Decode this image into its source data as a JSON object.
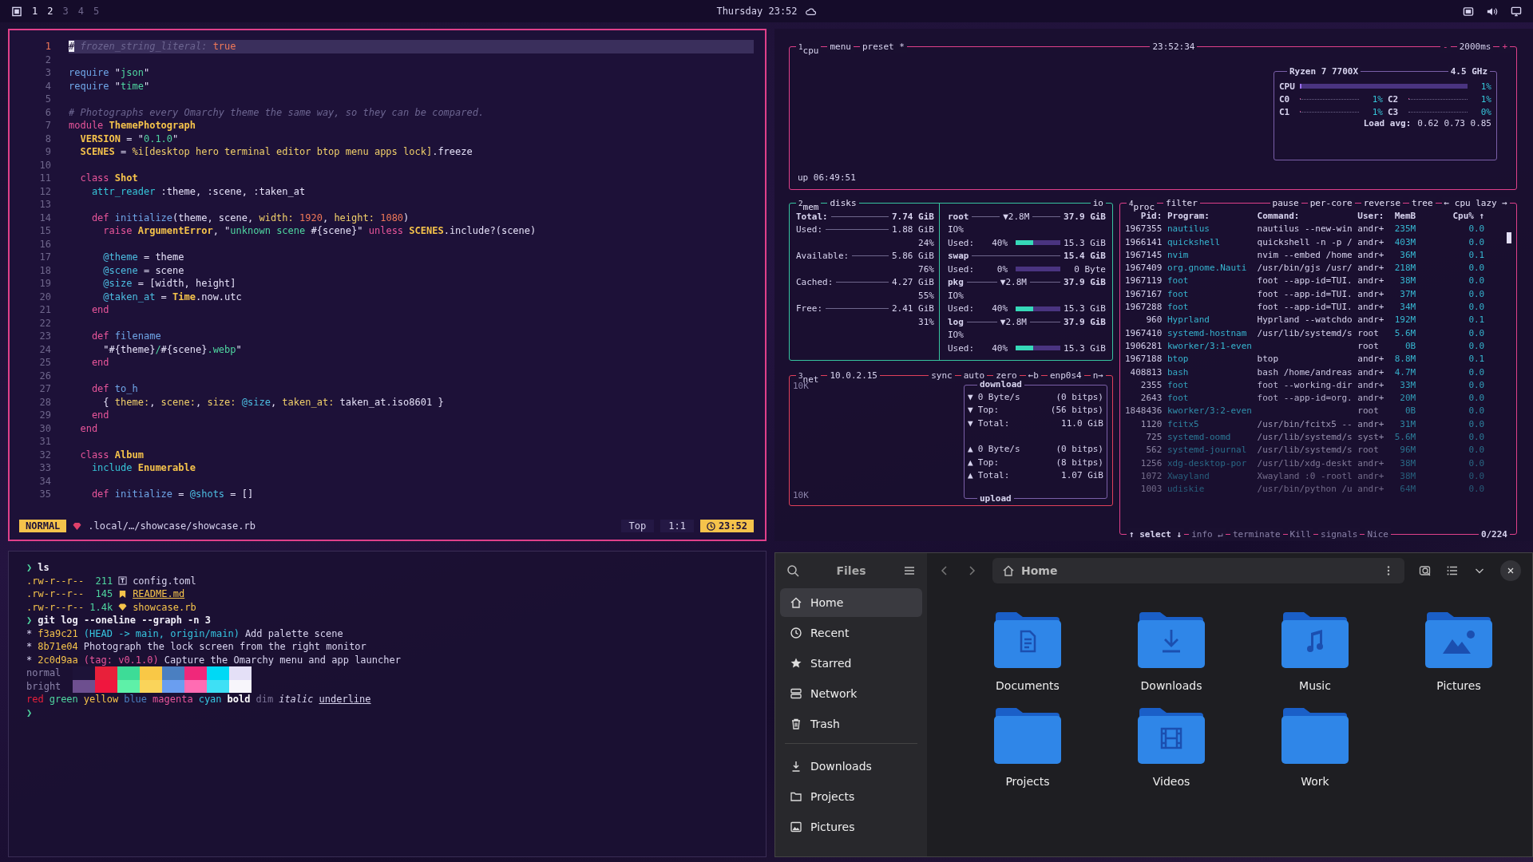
{
  "topbar": {
    "workspaces": [
      {
        "label": "1",
        "occupied": true
      },
      {
        "label": "2",
        "occupied": true
      },
      {
        "label": "3",
        "occupied": false
      },
      {
        "label": "4",
        "occupied": false
      },
      {
        "label": "5",
        "occupied": false
      }
    ],
    "clock": "Thursday 23:52"
  },
  "editor": {
    "lines": [
      {
        "n": "1",
        "current": true,
        "tokens": [
          {
            "t": "#",
            "kind": "cursor"
          },
          {
            "t": " frozen_string_literal:",
            "kind": "cm"
          },
          {
            "t": " true",
            "kind": "num"
          }
        ]
      },
      {
        "n": "2",
        "current": false
      },
      {
        "n": "3",
        "current": false,
        "tokens": [
          {
            "t": "require",
            "kind": "fn"
          },
          {
            "t": " \"",
            "kind": "plain"
          },
          {
            "t": "json",
            "kind": "str"
          },
          {
            "t": "\"",
            "kind": "plain"
          }
        ]
      },
      {
        "n": "4",
        "current": false,
        "tokens": [
          {
            "t": "require",
            "kind": "fn"
          },
          {
            "t": " \"",
            "kind": "plain"
          },
          {
            "t": "time",
            "kind": "str"
          },
          {
            "t": "\"",
            "kind": "plain"
          }
        ]
      },
      {
        "n": "5",
        "current": false
      },
      {
        "n": "6",
        "current": false,
        "tokens": [
          {
            "t": "# Photographs every Omarchy theme the same way, so they can be compared.",
            "kind": "cm"
          }
        ]
      },
      {
        "n": "7",
        "current": false,
        "tokens": [
          {
            "t": "module",
            "kind": "kw"
          },
          {
            "t": " ThemePhotograph",
            "kind": "const"
          }
        ]
      },
      {
        "n": "8",
        "current": false,
        "tokens": [
          {
            "t": "  VERSION",
            "kind": "const"
          },
          {
            "t": " = \"",
            "kind": "plain"
          },
          {
            "t": "0.1.0",
            "kind": "str"
          },
          {
            "t": "\"",
            "kind": "plain"
          }
        ]
      },
      {
        "n": "9",
        "current": false,
        "tokens": [
          {
            "t": "  SCENES",
            "kind": "const"
          },
          {
            "t": " = ",
            "kind": "plain"
          },
          {
            "t": "%i[desktop hero terminal editor btop menu apps lock]",
            "kind": "sym"
          },
          {
            "t": ".freeze",
            "kind": "plain"
          }
        ]
      },
      {
        "n": "10",
        "current": false
      },
      {
        "n": "11",
        "current": false,
        "tokens": [
          {
            "t": "  class",
            "kind": "kw"
          },
          {
            "t": " Shot",
            "kind": "const"
          }
        ]
      },
      {
        "n": "12",
        "current": false,
        "tokens": [
          {
            "t": "    attr_reader",
            "kind": "builtin"
          },
          {
            "t": " :theme, :scene, :taken_at",
            "kind": "plain"
          }
        ]
      },
      {
        "n": "13",
        "current": false
      },
      {
        "n": "14",
        "current": false,
        "tokens": [
          {
            "t": "    def",
            "kind": "kw"
          },
          {
            "t": " initialize",
            "kind": "fn"
          },
          {
            "t": "(theme, scene, ",
            "kind": "plain"
          },
          {
            "t": "width:",
            "kind": "sym"
          },
          {
            "t": " 1920",
            "kind": "num"
          },
          {
            "t": ", ",
            "kind": "plain"
          },
          {
            "t": "height:",
            "kind": "sym"
          },
          {
            "t": " 1080",
            "kind": "num"
          },
          {
            "t": ")",
            "kind": "plain"
          }
        ]
      },
      {
        "n": "15",
        "current": false,
        "tokens": [
          {
            "t": "      raise",
            "kind": "kw"
          },
          {
            "t": " ArgumentError",
            "kind": "const"
          },
          {
            "t": ", \"",
            "kind": "plain"
          },
          {
            "t": "unknown scene ",
            "kind": "str"
          },
          {
            "t": "#{scene}\"",
            "kind": "plain"
          },
          {
            "t": " unless",
            "kind": "kw"
          },
          {
            "t": " SCENES",
            "kind": "const"
          },
          {
            "t": ".include?(scene)",
            "kind": "plain"
          }
        ]
      },
      {
        "n": "16",
        "current": false
      },
      {
        "n": "17",
        "current": false,
        "tokens": [
          {
            "t": "      @theme",
            "kind": "ivar"
          },
          {
            "t": " = theme",
            "kind": "plain"
          }
        ]
      },
      {
        "n": "18",
        "current": false,
        "tokens": [
          {
            "t": "      @scene",
            "kind": "ivar"
          },
          {
            "t": " = scene",
            "kind": "plain"
          }
        ]
      },
      {
        "n": "19",
        "current": false,
        "tokens": [
          {
            "t": "      @size",
            "kind": "ivar"
          },
          {
            "t": " = [width, height]",
            "kind": "plain"
          }
        ]
      },
      {
        "n": "20",
        "current": false,
        "tokens": [
          {
            "t": "      @taken_at",
            "kind": "ivar"
          },
          {
            "t": " = ",
            "kind": "plain"
          },
          {
            "t": "Time",
            "kind": "const"
          },
          {
            "t": ".now.utc",
            "kind": "plain"
          }
        ]
      },
      {
        "n": "21",
        "current": false,
        "tokens": [
          {
            "t": "    end",
            "kind": "kw"
          }
        ]
      },
      {
        "n": "22",
        "current": false
      },
      {
        "n": "23",
        "current": false,
        "tokens": [
          {
            "t": "    def",
            "kind": "kw"
          },
          {
            "t": " filename",
            "kind": "fn"
          }
        ]
      },
      {
        "n": "24",
        "current": false,
        "tokens": [
          {
            "t": "      \"#{theme}",
            "kind": "plain"
          },
          {
            "t": "/",
            "kind": "str"
          },
          {
            "t": "#{scene}",
            "kind": "plain"
          },
          {
            "t": ".webp",
            "kind": "str"
          },
          {
            "t": "\"",
            "kind": "plain"
          }
        ]
      },
      {
        "n": "25",
        "current": false,
        "tokens": [
          {
            "t": "    end",
            "kind": "kw"
          }
        ]
      },
      {
        "n": "26",
        "current": false
      },
      {
        "n": "27",
        "current": false,
        "tokens": [
          {
            "t": "    def",
            "kind": "kw"
          },
          {
            "t": " to_h",
            "kind": "fn"
          }
        ]
      },
      {
        "n": "28",
        "current": false,
        "tokens": [
          {
            "t": "      { ",
            "kind": "plain"
          },
          {
            "t": "theme:",
            "kind": "sym"
          },
          {
            "t": ", ",
            "kind": "plain"
          },
          {
            "t": "scene:",
            "kind": "sym"
          },
          {
            "t": ", ",
            "kind": "plain"
          },
          {
            "t": "size:",
            "kind": "sym"
          },
          {
            "t": " @size",
            "kind": "ivar"
          },
          {
            "t": ", ",
            "kind": "plain"
          },
          {
            "t": "taken_at:",
            "kind": "sym"
          },
          {
            "t": " taken_at.iso8601 }",
            "kind": "plain"
          }
        ]
      },
      {
        "n": "29",
        "current": false,
        "tokens": [
          {
            "t": "    end",
            "kind": "kw"
          }
        ]
      },
      {
        "n": "30",
        "current": false,
        "tokens": [
          {
            "t": "  end",
            "kind": "kw"
          }
        ]
      },
      {
        "n": "31",
        "current": false
      },
      {
        "n": "32",
        "current": false,
        "tokens": [
          {
            "t": "  class",
            "kind": "kw"
          },
          {
            "t": " Album",
            "kind": "const"
          }
        ]
      },
      {
        "n": "33",
        "current": false,
        "tokens": [
          {
            "t": "    include",
            "kind": "builtin"
          },
          {
            "t": " Enumerable",
            "kind": "const"
          }
        ]
      },
      {
        "n": "34",
        "current": false
      },
      {
        "n": "35",
        "current": false,
        "tokens": [
          {
            "t": "    def",
            "kind": "kw"
          },
          {
            "t": " initialize",
            "kind": "fn"
          },
          {
            "t": " = ",
            "kind": "plain"
          },
          {
            "t": "@shots",
            "kind": "ivar"
          },
          {
            "t": " = []",
            "kind": "plain"
          }
        ]
      }
    ],
    "status": {
      "mode": "NORMAL",
      "path": ".local/…/showcase/showcase.rb",
      "scroll": "Top",
      "position": "1:1",
      "time": "23:52"
    }
  },
  "btop": {
    "cpu": {
      "tabs": [
        "$^{1}$cpu",
        "menu",
        "preset *"
      ],
      "clock": "23:52:34",
      "interval_dec": "-",
      "interval": "2000ms",
      "interval_inc": "+",
      "uptime": "up 06:49:51",
      "model": "Ryzen 7 7700X",
      "freq": "4.5 GHz",
      "total": {
        "label": "CPU",
        "level": 0.01,
        "reading": "1%"
      },
      "cores": [
        {
          "label": "C0",
          "level": 0.01,
          "reading": "1%"
        },
        {
          "label": "C2",
          "level": 0.01,
          "reading": "1%"
        },
        {
          "label": "C1",
          "level": 0.01,
          "reading": "1%"
        },
        {
          "label": "C3",
          "level": 0,
          "reading": "0%"
        }
      ],
      "load_label": "Load avg:",
      "load": "0.62 0.73 0.85"
    },
    "mem": {
      "title": "$^{2}$mem",
      "rows": [
        {
          "label": "Total:",
          "value": "7.74 GiB"
        },
        {
          "label": "Used:",
          "value": "1.88 GiB",
          "percent": "24%"
        },
        {
          "label": "Available:",
          "value": "5.86 GiB",
          "percent": "76%"
        },
        {
          "label": "Cached:",
          "value": "4.27 GiB",
          "percent": "55%"
        },
        {
          "label": "Free:",
          "value": "2.41 GiB",
          "percent": "31%"
        }
      ]
    },
    "disks": {
      "title": "disks",
      "io_title": "io",
      "items": [
        {
          "name": "root",
          "io_rate": "▼2.8M",
          "size": "37.9 GiB",
          "io_label": "IO%",
          "used_label": "Used:",
          "used_pct": "40%",
          "level": 0.4,
          "used": "15.3 GiB"
        },
        {
          "name": "swap",
          "size": "15.4 GiB",
          "used_label": "Used:",
          "used_pct": "0%",
          "level": 0,
          "used": "0 Byte"
        },
        {
          "name": "pkg",
          "io_rate": "▼2.8M",
          "size": "37.9 GiB",
          "io_label": "IO%",
          "used_label": "Used:",
          "used_pct": "40%",
          "level": 0.4,
          "used": "15.3 GiB"
        },
        {
          "name": "log",
          "io_rate": "▼2.8M",
          "size": "37.9 GiB",
          "io_label": "IO%",
          "used_label": "Used:",
          "used_pct": "40%",
          "level": 0.4,
          "used": "15.3 GiB"
        }
      ]
    },
    "net": {
      "title": "$^{3}$net",
      "address": "10.0.2.15",
      "options": [
        "sync",
        "auto",
        "zero",
        "←b",
        "enp0s4",
        "n→"
      ],
      "scale_top": "10K",
      "scale_bottom": "10K",
      "download_title": "download",
      "upload_title": "upload",
      "download": [
        {
          "arrow": "▼",
          "label": "0 Byte/s",
          "value": "(0 bitps)"
        },
        {
          "arrow": "▼",
          "label": "Top:",
          "value": "(56 bitps)"
        },
        {
          "arrow": "▼",
          "label": "Total:",
          "value": "11.0 GiB"
        }
      ],
      "upload": [
        {
          "arrow": "▲",
          "label": "0 Byte/s",
          "value": "(0 bitps)"
        },
        {
          "arrow": "▲",
          "label": "Top:",
          "value": "(8 bitps)"
        },
        {
          "arrow": "▲",
          "label": "Total:",
          "value": "1.07 GiB"
        }
      ]
    },
    "proc": {
      "title": "$^{4}$proc",
      "filter": "filter",
      "options": [
        "pause",
        "per-core",
        "reverse",
        "tree",
        "← cpu lazy →"
      ],
      "columns": [
        "Pid:",
        "Program:",
        "Command:",
        "User:",
        "MemB",
        "Cpu% ↑"
      ],
      "rows": [
        {
          "pid": "1967355",
          "program": "nautilus",
          "command": "nautilus --new-win",
          "user": "andr+",
          "mem": "235M",
          "cpu": "0.0"
        },
        {
          "pid": "1966141",
          "program": "quickshell",
          "command": "quickshell -n -p /",
          "user": "andr+",
          "mem": "403M",
          "cpu": "0.0"
        },
        {
          "pid": "1967145",
          "program": "nvim",
          "command": "nvim --embed /home",
          "user": "andr+",
          "mem": "36M",
          "cpu": "0.1"
        },
        {
          "pid": "1967409",
          "program": "org.gnome.Nauti",
          "command": "/usr/bin/gjs /usr/",
          "user": "andr+",
          "mem": "218M",
          "cpu": "0.0"
        },
        {
          "pid": "1967119",
          "program": "foot",
          "command": "foot --app-id=TUI.",
          "user": "andr+",
          "mem": "38M",
          "cpu": "0.0"
        },
        {
          "pid": "1967167",
          "program": "foot",
          "command": "foot --app-id=TUI.",
          "user": "andr+",
          "mem": "37M",
          "cpu": "0.0"
        },
        {
          "pid": "1967288",
          "program": "foot",
          "command": "foot --app-id=TUI.",
          "user": "andr+",
          "mem": "34M",
          "cpu": "0.0"
        },
        {
          "pid": "960",
          "program": "Hyprland",
          "command": "Hyprland --watchdo",
          "user": "andr+",
          "mem": "192M",
          "cpu": "0.1"
        },
        {
          "pid": "1967410",
          "program": "systemd-hostnam",
          "command": "/usr/lib/systemd/s",
          "user": "root",
          "mem": "5.6M",
          "cpu": "0.0"
        },
        {
          "pid": "1906281",
          "program": "kworker/3:1-even",
          "user": "root",
          "mem": "0B",
          "cpu": "0.0"
        },
        {
          "pid": "1967188",
          "program": "btop",
          "command": "btop",
          "user": "andr+",
          "mem": "8.8M",
          "cpu": "0.1"
        },
        {
          "pid": "408813",
          "program": "bash",
          "command": "bash /home/andreas",
          "user": "andr+",
          "mem": "4.7M",
          "cpu": "0.0"
        },
        {
          "pid": "2355",
          "program": "foot",
          "command": "foot --working-dir",
          "user": "andr+",
          "mem": "33M",
          "cpu": "0.0"
        },
        {
          "pid": "2643",
          "program": "foot",
          "command": "foot --app-id=org.",
          "user": "andr+",
          "mem": "20M",
          "cpu": "0.0"
        },
        {
          "pid": "1848436",
          "program": "kworker/3:2-even",
          "user": "root",
          "mem": "0B",
          "cpu": "0.0"
        },
        {
          "pid": "1120",
          "program": "fcitx5",
          "command": "/usr/bin/fcitx5 --",
          "user": "andr+",
          "mem": "31M",
          "cpu": "0.0"
        },
        {
          "pid": "725",
          "program": "systemd-oomd",
          "command": "/usr/lib/systemd/s",
          "user": "syst+",
          "mem": "5.6M",
          "cpu": "0.0"
        },
        {
          "pid": "562",
          "program": "systemd-journal",
          "command": "/usr/lib/systemd/s",
          "user": "root",
          "mem": "96M",
          "cpu": "0.0"
        },
        {
          "pid": "1256",
          "program": "xdg-desktop-por",
          "command": "/usr/lib/xdg-deskt",
          "user": "andr+",
          "mem": "38M",
          "cpu": "0.0"
        },
        {
          "pid": "1072",
          "program": "Xwayland",
          "command": "Xwayland :0 -rootl",
          "user": "andr+",
          "mem": "38M",
          "cpu": "0.0"
        },
        {
          "pid": "1003",
          "program": "udiskie",
          "command": "/usr/bin/python /u",
          "user": "andr+",
          "mem": "64M",
          "cpu": "0.0"
        }
      ],
      "footer": [
        "↑ select ↓",
        "info ↵",
        "terminate",
        "Kill",
        "signals",
        "Nice"
      ],
      "count": "0/224"
    }
  },
  "terminal": {
    "lines": [
      {
        "kind": "prompt",
        "symbol": "❯",
        "cmd": "ls"
      },
      {
        "kind": "file",
        "perms": ".rw-r--r--",
        "size": "211",
        "icon": {
          "kind": "toml"
        },
        "name": "config.toml"
      },
      {
        "kind": "file",
        "perms": ".rw-r--r--",
        "size": "145",
        "icon": {
          "kind": "markdown"
        },
        "name": "README.md"
      },
      {
        "kind": "file",
        "perms": ".rw-r--r--",
        "size": "1.4k",
        "icon": {
          "kind": "ruby"
        },
        "name": "showcase.rb"
      },
      {
        "kind": "prompt",
        "symbol": "❯",
        "cmd": "git log --oneline --graph -n 3"
      },
      {
        "kind": "commit",
        "graph": "*",
        "hash": "f3a9c21",
        "refs": {
          "t": "(HEAD -> main, origin/main)",
          "kind": "head"
        },
        "message": "Add palette scene"
      },
      {
        "kind": "commit",
        "graph": "*",
        "hash": "8b71e04",
        "message": "Photograph the lock screen from the right monitor"
      },
      {
        "kind": "commit",
        "graph": "*",
        "hash": "2c0d9aa",
        "refs": {
          "t": "(tag: v0.1.0)",
          "kind": "tag"
        },
        "message": "Capture the Omarchy menu and app launcher"
      },
      {
        "kind": "palette",
        "label": "normal",
        "colors": [
          {
            "color": "#1d1338"
          },
          {
            "color": "#e8203a"
          },
          {
            "color": "#3ddc97"
          },
          {
            "color": "#f9c846"
          },
          {
            "color": "#4a7fc1"
          },
          {
            "color": "#f0287a"
          },
          {
            "color": "#00d9f5"
          },
          {
            "color": "#e4e0f7"
          }
        ]
      },
      {
        "kind": "palette",
        "label": "bright",
        "colors": [
          {
            "color": "#6d4f8f"
          },
          {
            "color": "#f0163e"
          },
          {
            "color": "#5ef0a8"
          },
          {
            "color": "#fad45a"
          },
          {
            "color": "#6a9ef0"
          },
          {
            "color": "#ff6cb3"
          },
          {
            "color": "#3ee0f5"
          },
          {
            "color": "#f7f6fb"
          }
        ]
      },
      {
        "kind": "styles",
        "words": [
          {
            "t": "red",
            "kind": "red"
          },
          {
            "t": "green",
            "kind": "green"
          },
          {
            "t": "yellow",
            "kind": "yellow"
          },
          {
            "t": "blue",
            "kind": "blue"
          },
          {
            "t": "magenta",
            "kind": "magenta"
          },
          {
            "t": "cyan",
            "kind": "cyan"
          },
          {
            "t": "bold",
            "kind": "bold"
          },
          {
            "t": "dim",
            "kind": "dim"
          },
          {
            "t": "italic",
            "kind": "italic"
          },
          {
            "t": "underline",
            "kind": "underline"
          }
        ]
      },
      {
        "kind": "prompt",
        "symbol": "❯"
      }
    ]
  },
  "files": {
    "title": "Files",
    "path": "Home",
    "places": [
      {
        "label": "Home",
        "kind": "home",
        "selected": true
      },
      {
        "label": "Recent",
        "kind": "clock",
        "selected": false
      },
      {
        "label": "Starred",
        "kind": "star",
        "selected": false
      },
      {
        "label": "Network",
        "kind": "network",
        "selected": false
      },
      {
        "label": "Trash",
        "kind": "trash",
        "selected": false
      }
    ],
    "bookmarks": [
      {
        "label": "Downloads",
        "kind": "download",
        "selected": false
      },
      {
        "label": "Projects",
        "kind": "folder",
        "selected": false
      },
      {
        "label": "Pictures",
        "kind": "image",
        "selected": false
      }
    ],
    "folders": [
      {
        "label": "Documents",
        "kind": "documents"
      },
      {
        "label": "Downloads",
        "kind": "downloads"
      },
      {
        "label": "Music",
        "kind": "music"
      },
      {
        "label": "Pictures",
        "kind": "pictures"
      },
      {
        "label": "Projects",
        "kind": "plain"
      },
      {
        "label": "Videos",
        "kind": "videos"
      },
      {
        "label": "Work",
        "kind": "plain"
      }
    ]
  }
}
